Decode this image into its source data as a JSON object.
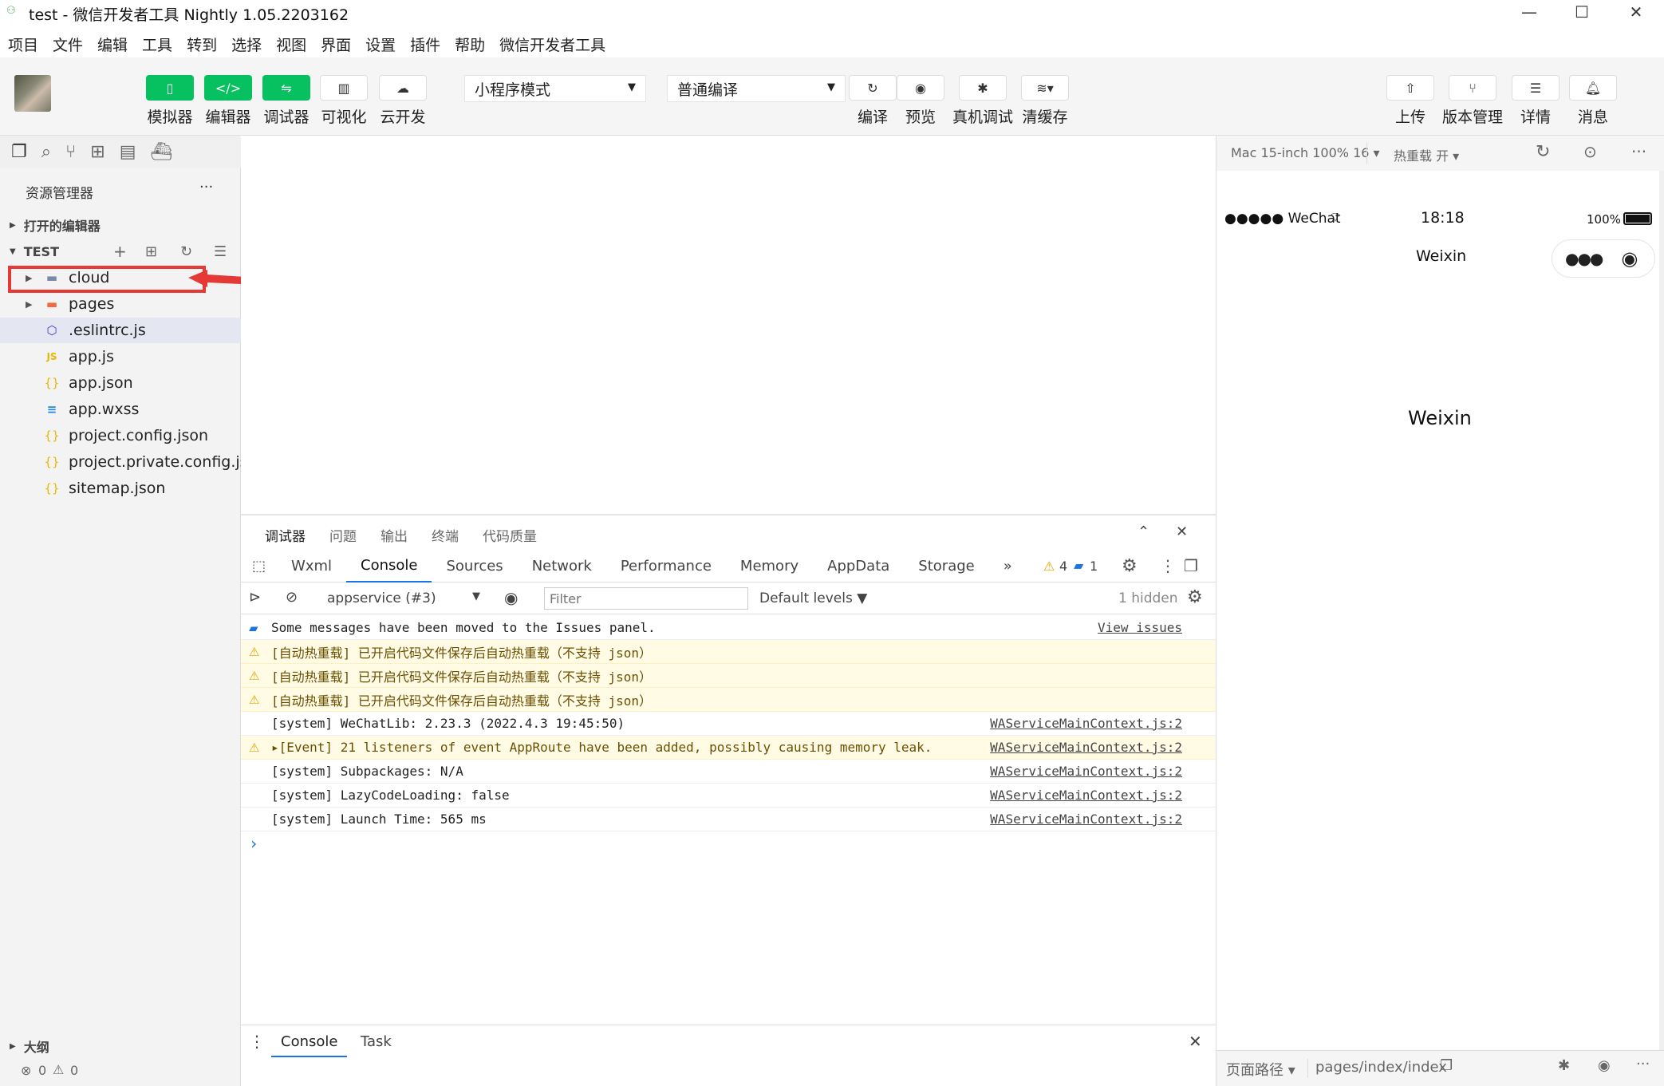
{
  "window": {
    "title": "test - 微信开发者工具 Nightly 1.05.2203162",
    "minimize": "—",
    "maximize": "☐",
    "close": "✕"
  },
  "menu": [
    "项目",
    "文件",
    "编辑",
    "工具",
    "转到",
    "选择",
    "视图",
    "界面",
    "设置",
    "插件",
    "帮助",
    "微信开发者工具"
  ],
  "toolbar": {
    "simulator": "模拟器",
    "editor": "编辑器",
    "debugger": "调试器",
    "visual": "可视化",
    "cloud": "云开发",
    "mode": "小程序模式",
    "compile_mode": "普通编译",
    "compile": "编译",
    "preview": "预览",
    "real_debug": "真机调试",
    "clear_cache": "清缓存",
    "upload": "上传",
    "version": "版本管理",
    "details": "详情",
    "messages": "消息"
  },
  "explorer": {
    "title": "资源管理器",
    "more": "···",
    "open_editors": "打开的编辑器",
    "project": "TEST",
    "outline": "大纲",
    "files": [
      {
        "name": "cloud",
        "icon": "folder-icon"
      },
      {
        "name": "pages",
        "icon": "folder-icon"
      },
      {
        "name": ".eslintrc.js",
        "icon": "eslint-icon"
      },
      {
        "name": "app.js",
        "icon": "js-icon"
      },
      {
        "name": "app.json",
        "icon": "json-icon"
      },
      {
        "name": "app.wxss",
        "icon": "css-icon"
      },
      {
        "name": "project.config.json",
        "icon": "json-icon"
      },
      {
        "name": "project.private.config.js...",
        "icon": "json-icon"
      },
      {
        "name": "sitemap.json",
        "icon": "json-icon"
      }
    ]
  },
  "status": {
    "errors": "0",
    "warnings": "0"
  },
  "debugger": {
    "tabs": [
      "调试器",
      "问题",
      "输出",
      "终端",
      "代码质量"
    ],
    "devtools_tabs": [
      "Wxml",
      "Console",
      "Sources",
      "Network",
      "Performance",
      "Memory",
      "AppData",
      "Storage"
    ],
    "more_tabs": "»",
    "warn_count": "4",
    "info_count": "1",
    "context": "appservice (#3)",
    "filter_placeholder": "Filter",
    "levels": "Default levels ▼",
    "hidden": "1 hidden",
    "logs": [
      {
        "text": "Some messages have been moved to the Issues panel.",
        "src": "View issues",
        "level": "info"
      },
      {
        "text": "[自动热重载] 已开启代码文件保存后自动热重载（不支持 json）",
        "src": "",
        "level": "warn"
      },
      {
        "text": "[自动热重载] 已开启代码文件保存后自动热重载（不支持 json）",
        "src": "",
        "level": "warn"
      },
      {
        "text": "[自动热重载] 已开启代码文件保存后自动热重载（不支持 json）",
        "src": "",
        "level": "warn"
      },
      {
        "text": "[system] WeChatLib: 2.23.3 (2022.4.3 19:45:50)",
        "src": "WAServiceMainContext.js:2",
        "level": "log"
      },
      {
        "text": "▸[Event] 21 listeners of event AppRoute have been added, possibly causing memory leak.",
        "src": "WAServiceMainContext.js:2",
        "level": "warn"
      },
      {
        "text": "[system] Subpackages: N/A",
        "src": "WAServiceMainContext.js:2",
        "level": "log"
      },
      {
        "text": "[system] LazyCodeLoading: false",
        "src": "WAServiceMainContext.js:2",
        "level": "log"
      },
      {
        "text": "[system] Launch Time: 565 ms",
        "src": "WAServiceMainContext.js:2",
        "level": "log"
      }
    ],
    "prompt": "›",
    "drawer_tabs": [
      "Console",
      "Task"
    ]
  },
  "simulator": {
    "device": "Mac 15-inch 100% 16 ▾",
    "hot_reload": "热重载 开 ▾",
    "carrier": "●●●●● WeChat",
    "time": "18:18",
    "battery": "100%",
    "nav_title": "Weixin",
    "page_text": "Weixin",
    "path_label": "页面路径 ▾",
    "path": "pages/index/index"
  }
}
